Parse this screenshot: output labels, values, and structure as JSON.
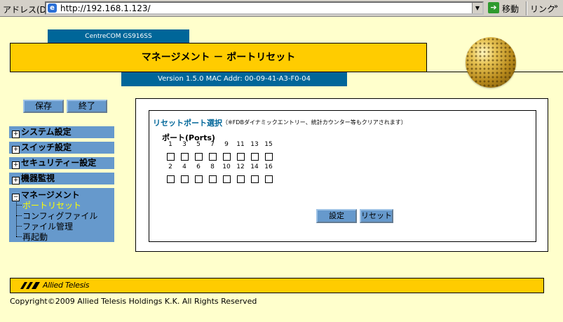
{
  "browser": {
    "address_label": "アドレス(D)",
    "url": "http://192.168.1.123/",
    "go_label": "移動",
    "links_label": "リンク",
    "links_arrow": "»"
  },
  "header": {
    "model": "CentreCOM GS916SS",
    "title": "マネージメント － ポートリセット",
    "version": "Version 1.5.0 MAC Addr: 00-09-41-A3-F0-04"
  },
  "actions": {
    "save_label": "保存",
    "end_label": "終了"
  },
  "menu": {
    "items": [
      {
        "label": "システム設定",
        "toggle": "+"
      },
      {
        "label": "スイッチ設定",
        "toggle": "+"
      },
      {
        "label": "セキュリティー設定",
        "toggle": "+"
      },
      {
        "label": "機器監視",
        "toggle": "+"
      }
    ],
    "management": {
      "label": "マネージメント",
      "toggle": "−",
      "subitems": [
        "ポートリセット",
        "コンフィグファイル",
        "ファイル管理",
        "再起動"
      ]
    }
  },
  "reset": {
    "title": "リセットポート選択",
    "note": "（※FDBダイナミックエントリー、統計カウンター等もクリアされます）",
    "ports_label": "ポート(Ports)",
    "odd_ports": [
      "1",
      "3",
      "5",
      "7",
      "9",
      "11",
      "13",
      "15"
    ],
    "even_ports": [
      "2",
      "4",
      "6",
      "8",
      "10",
      "12",
      "14",
      "16"
    ],
    "set_label": "設定",
    "reset_label": "リセット"
  },
  "footer": {
    "logo": "Allied Telesis",
    "copyright": "Copyright©2009 Allied Telesis Holdings K.K. All Rights Reserved"
  }
}
